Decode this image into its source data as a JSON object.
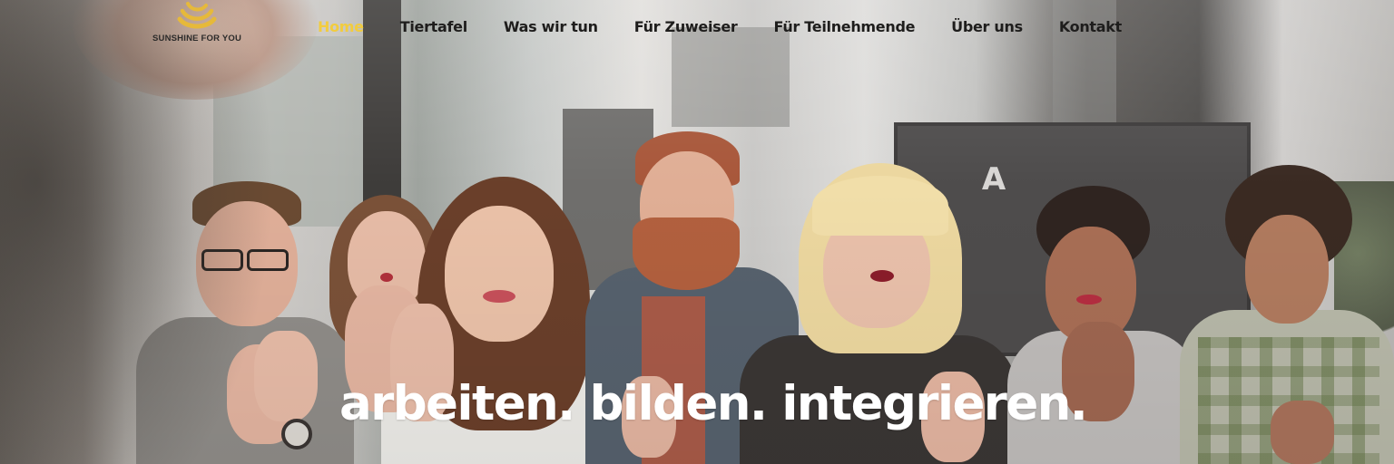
{
  "logo": {
    "text": "SUNSHINE FOR YOU",
    "accent_color": "#e6b93a"
  },
  "nav": {
    "items": [
      {
        "label": "Home",
        "active": true
      },
      {
        "label": "Tiertafel",
        "active": false
      },
      {
        "label": "Was wir tun",
        "active": false
      },
      {
        "label": "Für Zuweiser",
        "active": false
      },
      {
        "label": "Für Teilnehmende",
        "active": false
      },
      {
        "label": "Über uns",
        "active": false
      },
      {
        "label": "Kontakt",
        "active": false
      }
    ],
    "active_color": "#f2cc3e"
  },
  "hero": {
    "headline": "arbeiten. bilden. integrieren.",
    "background_letter": "A"
  }
}
